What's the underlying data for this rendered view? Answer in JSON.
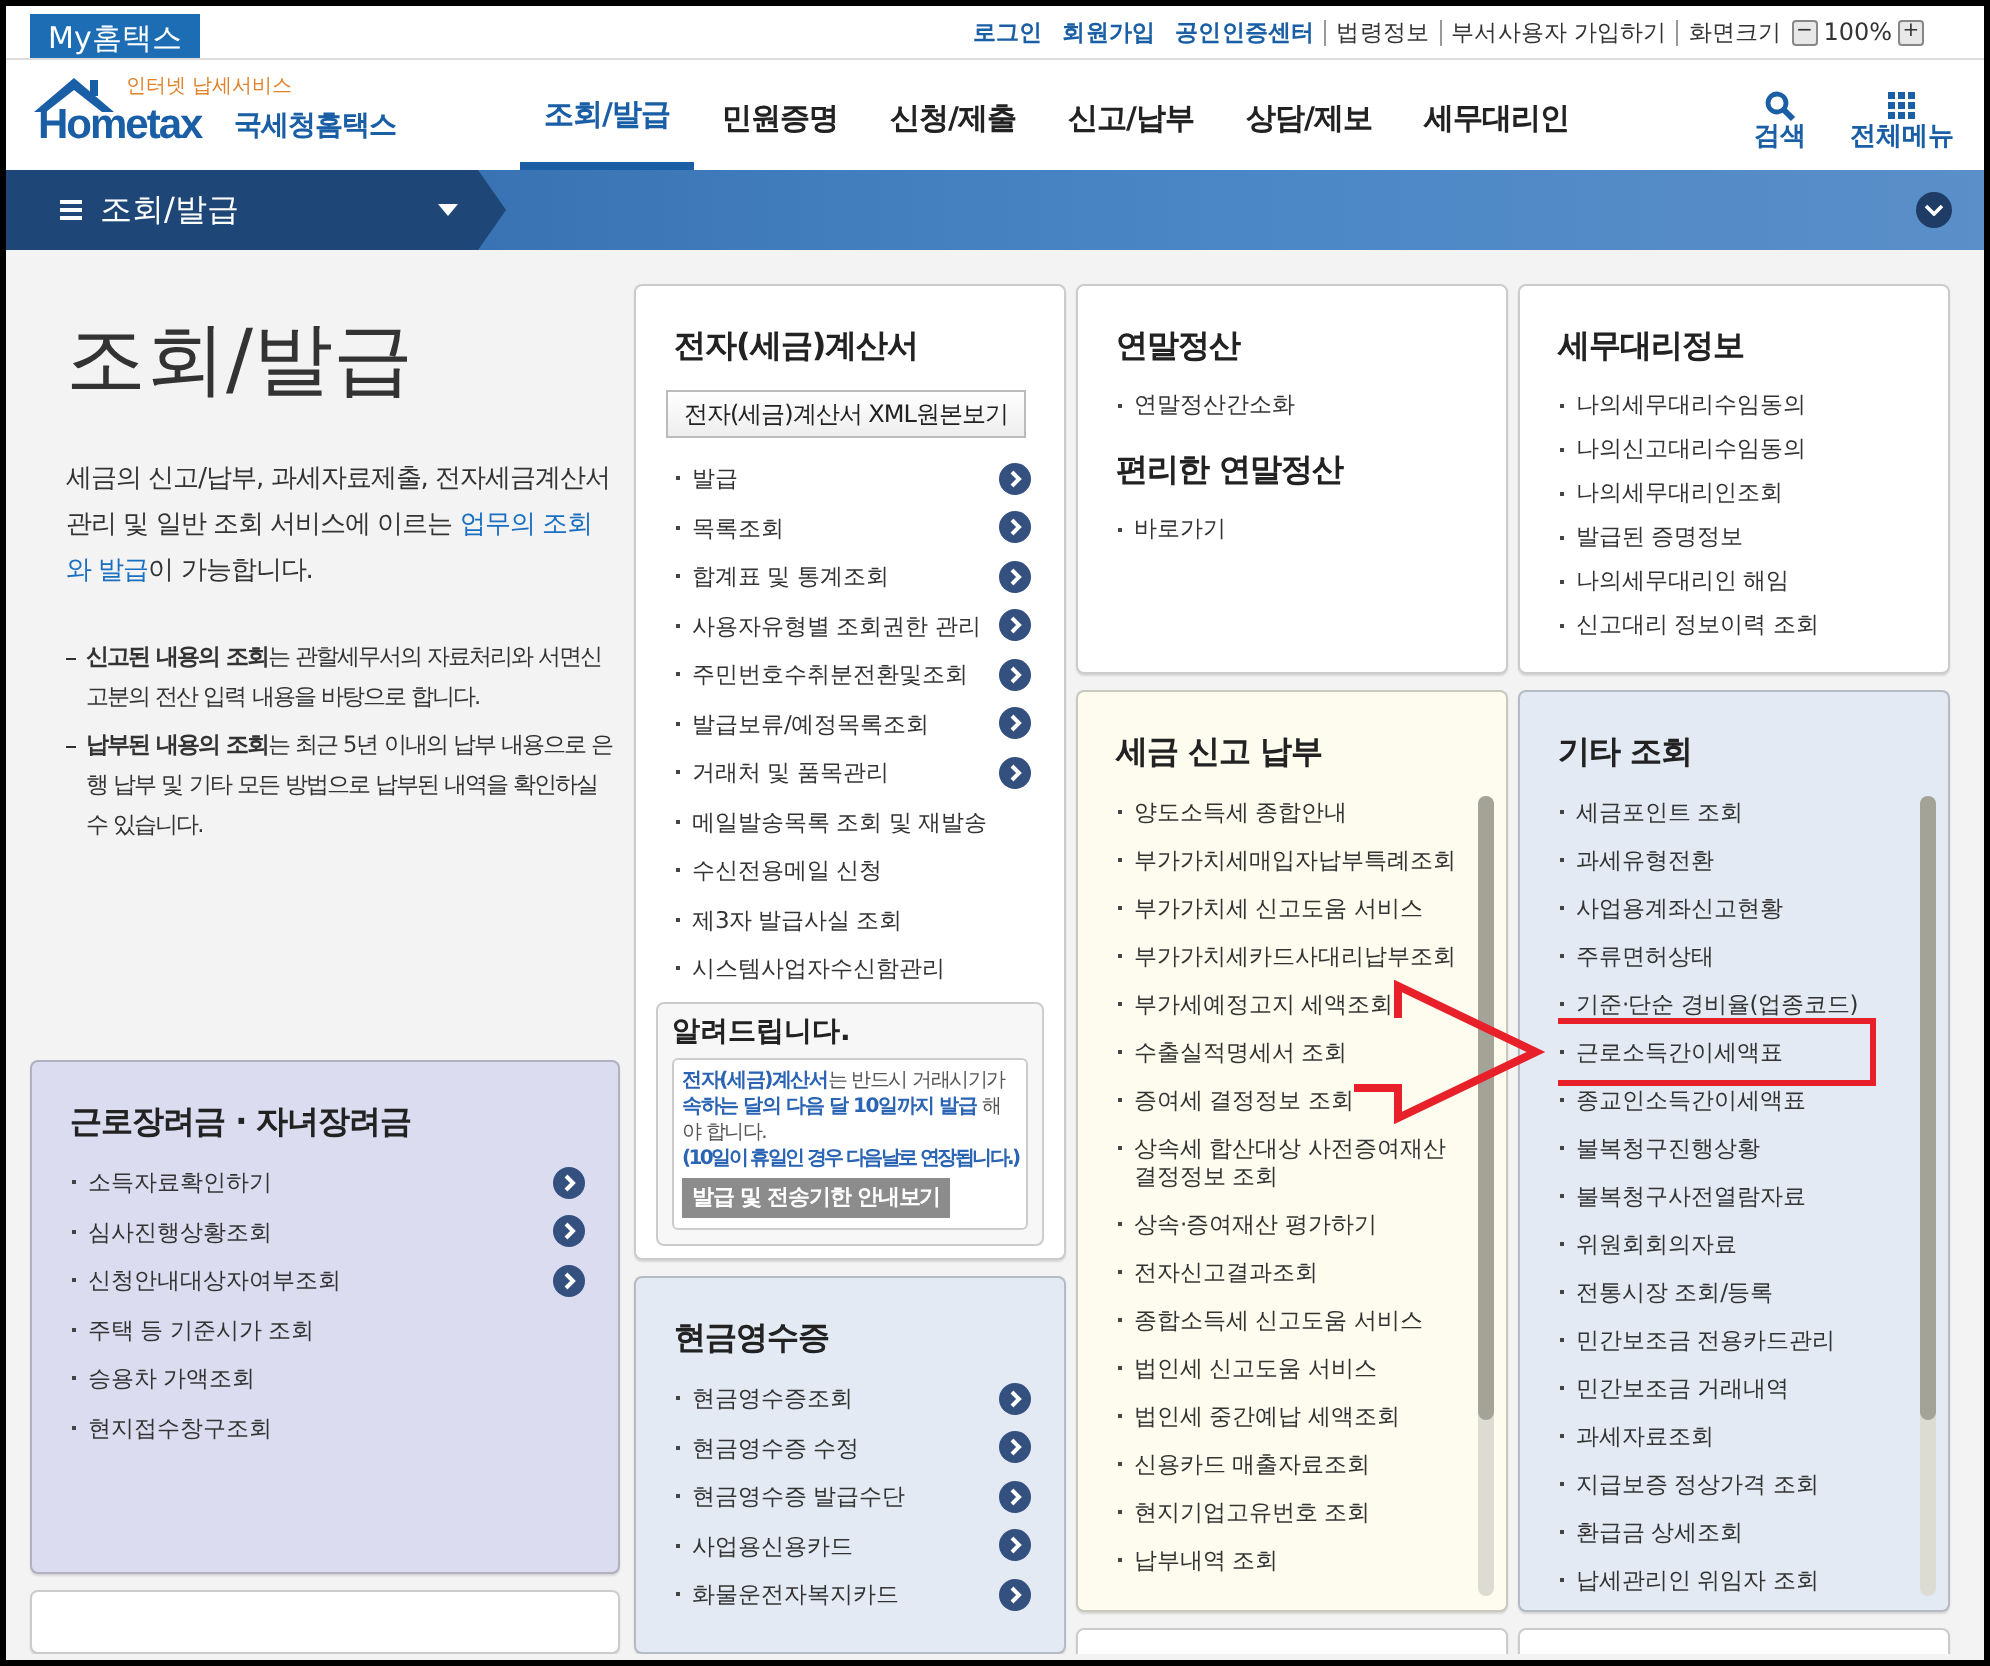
{
  "top_bar": {
    "my_tab": "My홈택스",
    "links": [
      {
        "label": "로그인",
        "kind": "strong"
      },
      {
        "label": "회원가입",
        "kind": "strong"
      },
      {
        "label": "공인인증센터",
        "kind": "strong"
      },
      {
        "label": "법령정보",
        "kind": "plain"
      },
      {
        "label": "부서사용자 가입하기",
        "kind": "plain"
      }
    ],
    "zoom": {
      "label": "화면크기",
      "minus": "−",
      "value": "100%",
      "plus": "+"
    }
  },
  "header": {
    "logo": {
      "tagline": "인터넷 납세서비스",
      "wordmark": "Hometax",
      "name": "국세청홈택스"
    },
    "tabs": [
      {
        "label": "조회/발급",
        "selected": true
      },
      {
        "label": "민원증명",
        "selected": false
      },
      {
        "label": "신청/제출",
        "selected": false
      },
      {
        "label": "신고/납부",
        "selected": false
      },
      {
        "label": "상담/제보",
        "selected": false
      },
      {
        "label": "세무대리인",
        "selected": false
      }
    ],
    "tools": [
      {
        "label": "검색",
        "kind": "search"
      },
      {
        "label": "전체메뉴",
        "kind": "menu"
      }
    ]
  },
  "section_bar": {
    "title": "조회/발급"
  },
  "left_column": {
    "title": "조회/발급",
    "description": [
      {
        "text": "세금의 신고/납부, 과세자료제출, 전자세금계산서 관리 및 일반 조회 서비스에 이르는 ",
        "highlight": false
      },
      {
        "text": "업무의 조회와 발급",
        "highlight": true
      },
      {
        "text": "이 가능합니다.",
        "highlight": false
      }
    ],
    "notes": [
      "**신고된 내용의 조회**는 관할세무서의 자료처리와 서면신고분의 전산 입력 내용을 바탕으로 합니다.",
      "**납부된 내용의 조회**는 최근 5년 이내의 납부 내용으로 은행 납부 및 기타 모든 방법으로 납부된 내역을 확인하실 수 있습니다."
    ],
    "cards": [
      {
        "color": "#dcdcf1",
        "sections": [
          {
            "title": "근로장려금 · 자녀장려금",
            "items": [
              {
                "label": "소득자료확인하기",
                "arrow": true
              },
              {
                "label": "심사진행상황조회",
                "arrow": true
              },
              {
                "label": "신청안내대상자여부조회",
                "arrow": true
              },
              {
                "label": "주택 등 기준시가 조회",
                "arrow": false
              },
              {
                "label": "승용차 가액조회",
                "arrow": false
              },
              {
                "label": "현지접수창구조회",
                "arrow": false
              }
            ]
          }
        ]
      },
      {
        "color": "#ffffff"
      }
    ]
  },
  "columns": [
    {
      "cards": [
        {
          "color": "#ffffff",
          "sections": [
            {
              "title": "전자(세금)계산서",
              "button": "전자(세금)계산서 XML원본보기",
              "items": [
                {
                  "label": "발급",
                  "arrow": true
                },
                {
                  "label": "목록조회",
                  "arrow": true
                },
                {
                  "label": "합계표 및 통계조회",
                  "arrow": true
                },
                {
                  "label": "사용자유형별 조회권한 관리",
                  "arrow": true
                },
                {
                  "label": "주민번호수취분전환및조회",
                  "arrow": true
                },
                {
                  "label": "발급보류/예정목록조회",
                  "arrow": true
                },
                {
                  "label": "거래처 및 품목관리",
                  "arrow": true
                },
                {
                  "label": "메일발송목록 조회 및 재발송",
                  "arrow": false
                },
                {
                  "label": "수신전용메일 신청",
                  "arrow": false
                },
                {
                  "label": "제3자 발급사실 조회",
                  "arrow": false
                },
                {
                  "label": "시스템사업자수신함관리",
                  "arrow": false
                }
              ]
            }
          ],
          "notice": {
            "title": "알려드립니다.",
            "text": "**전자(세금)계산서**는 반드시 거래시기가 **속하는 달의 다음 달 10일까지 발급** 해야 합니다.",
            "subtext": "(10일이 휴일인 경우 다음날로 연장됩니다.)",
            "button": "발급 및 전송기한 안내보기"
          }
        },
        {
          "color": "#e3eaf3",
          "sections": [
            {
              "title": "현금영수증",
              "items": [
                {
                  "label": "현금영수증조회",
                  "arrow": true
                },
                {
                  "label": "현금영수증 수정",
                  "arrow": true
                },
                {
                  "label": "현금영수증 발급수단",
                  "arrow": true
                },
                {
                  "label": "사업용신용카드",
                  "arrow": true
                },
                {
                  "label": "화물운전자복지카드",
                  "arrow": true
                }
              ]
            }
          ]
        }
      ]
    },
    {
      "cards": [
        {
          "color": "#ffffff",
          "sections": [
            {
              "title": "연말정산",
              "items": [
                {
                  "label": "연말정산간소화",
                  "arrow": false
                }
              ]
            },
            {
              "title": "편리한 연말정산",
              "items": [
                {
                  "label": "바로가기",
                  "arrow": false
                }
              ]
            }
          ]
        },
        {
          "color": "#fdfcee",
          "scrollable": true,
          "sections": [
            {
              "title": "세금 신고 납부",
              "items": [
                {
                  "label": "양도소득세 종합안내",
                  "arrow": false
                },
                {
                  "label": "부가가치세매입자납부특례조회",
                  "arrow": false
                },
                {
                  "label": "부가가치세 신고도움 서비스",
                  "arrow": false
                },
                {
                  "label": "부가가치세카드사대리납부조회",
                  "arrow": false
                },
                {
                  "label": "부가세예정고지 세액조회",
                  "arrow": false
                },
                {
                  "label": "수출실적명세서 조회",
                  "arrow": false
                },
                {
                  "label": "증여세 결정정보 조회",
                  "arrow": false
                },
                {
                  "label": "상속세 합산대상 사전증여재산 결정정보 조회",
                  "arrow": false
                },
                {
                  "label": "상속·증여재산 평가하기",
                  "arrow": false
                },
                {
                  "label": "전자신고결과조회",
                  "arrow": false
                },
                {
                  "label": "종합소득세 신고도움 서비스",
                  "arrow": false
                },
                {
                  "label": "법인세 신고도움 서비스",
                  "arrow": false
                },
                {
                  "label": "법인세 중간예납 세액조회",
                  "arrow": false
                },
                {
                  "label": "신용카드 매출자료조회",
                  "arrow": false
                },
                {
                  "label": "현지기업고유번호 조회",
                  "arrow": false
                },
                {
                  "label": "납부내역 조회",
                  "arrow": false
                }
              ]
            }
          ]
        },
        {
          "color": "#ffffff"
        }
      ]
    },
    {
      "cards": [
        {
          "color": "#ffffff",
          "sections": [
            {
              "title": "세무대리정보",
              "items": [
                {
                  "label": "나의세무대리수임동의",
                  "arrow": false
                },
                {
                  "label": "나의신고대리수임동의",
                  "arrow": false
                },
                {
                  "label": "나의세무대리인조회",
                  "arrow": false
                },
                {
                  "label": "발급된 증명정보",
                  "arrow": false
                },
                {
                  "label": "나의세무대리인 해임",
                  "arrow": false
                },
                {
                  "label": "신고대리 정보이력 조회",
                  "arrow": false
                }
              ]
            }
          ]
        },
        {
          "color": "#e3eaf3",
          "scrollable": true,
          "sections": [
            {
              "title": "기타 조회",
              "items": [
                {
                  "label": "세금포인트 조회",
                  "arrow": false
                },
                {
                  "label": "과세유형전환",
                  "arrow": false
                },
                {
                  "label": "사업용계좌신고현황",
                  "arrow": false
                },
                {
                  "label": "주류면허상태",
                  "arrow": false
                },
                {
                  "label": "기준·단순 경비율(업종코드)",
                  "arrow": false
                },
                {
                  "label": "근로소득간이세액표",
                  "arrow": false,
                  "highlighted": true
                },
                {
                  "label": "종교인소득간이세액표",
                  "arrow": false
                },
                {
                  "label": "불복청구진행상황",
                  "arrow": false
                },
                {
                  "label": "불복청구사전열람자료",
                  "arrow": false
                },
                {
                  "label": "위원회회의자료",
                  "arrow": false
                },
                {
                  "label": "전통시장 조회/등록",
                  "arrow": false
                },
                {
                  "label": "민간보조금 전용카드관리",
                  "arrow": false
                },
                {
                  "label": "민간보조금 거래내역",
                  "arrow": false
                },
                {
                  "label": "과세자료조회",
                  "arrow": false
                },
                {
                  "label": "지급보증 정상가격 조회",
                  "arrow": false
                },
                {
                  "label": "환급금 상세조회",
                  "arrow": false
                },
                {
                  "label": "납세관리인 위임자 조회",
                  "arrow": false
                }
              ]
            }
          ]
        },
        {
          "color": "#ffffff"
        }
      ]
    }
  ],
  "annotations": [
    {
      "kind": "arrow"
    }
  ]
}
